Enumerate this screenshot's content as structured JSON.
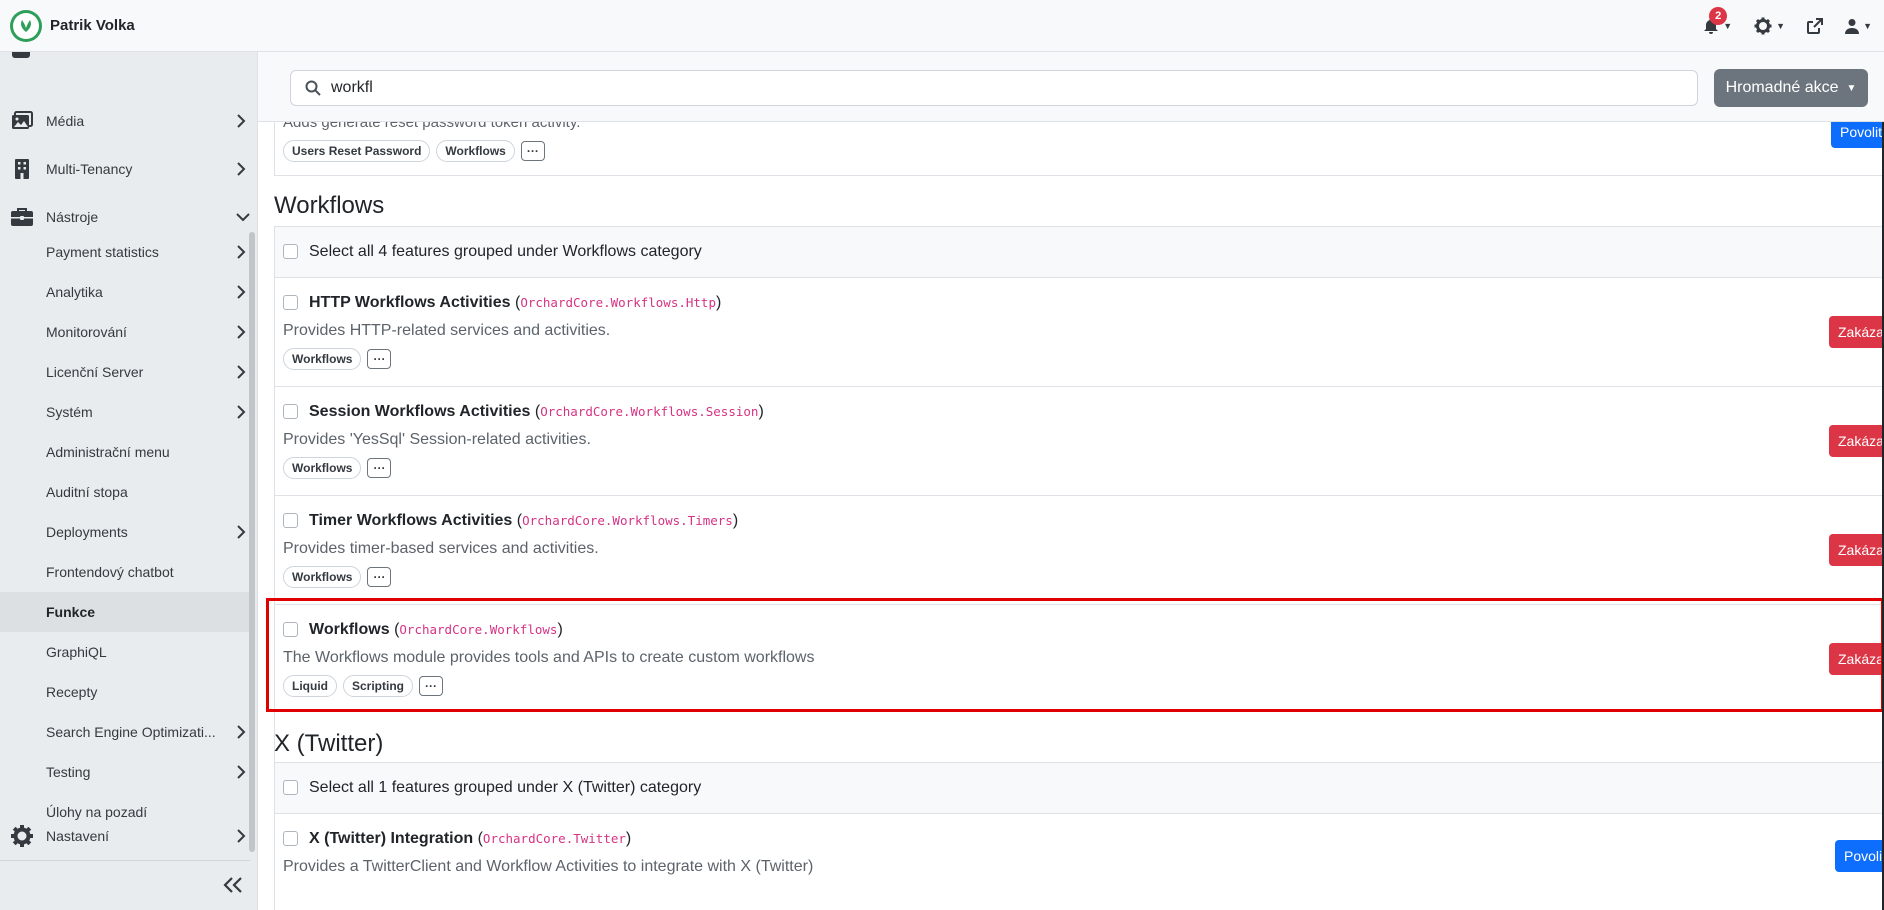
{
  "header": {
    "user_name": "Patrik Volka",
    "notification_count": "2"
  },
  "sidebar": {
    "items": [
      {
        "label": "Média"
      },
      {
        "label": "Multi-Tenancy"
      },
      {
        "label": "Nástroje"
      }
    ],
    "sub_items": [
      {
        "label": "Payment statistics"
      },
      {
        "label": "Analytika"
      },
      {
        "label": "Monitorování"
      },
      {
        "label": "Licenční Server"
      },
      {
        "label": "Systém"
      },
      {
        "label": "Administrační menu"
      },
      {
        "label": "Auditní stopa"
      },
      {
        "label": "Deployments"
      },
      {
        "label": "Frontendový chatbot"
      },
      {
        "label": "Funkce"
      },
      {
        "label": "GraphiQL"
      },
      {
        "label": "Recepty"
      },
      {
        "label": "Search Engine Optimizati..."
      },
      {
        "label": "Testing"
      },
      {
        "label": "Úlohy na pozadí"
      }
    ],
    "settings_label": "Nastavení"
  },
  "search": {
    "value": "workfl",
    "bulk_label": "Hromadné akce"
  },
  "top_partial": {
    "desc": "Adds generate reset password token activity.",
    "tags": [
      "Users Reset Password",
      "Workflows"
    ],
    "button": "Povolit"
  },
  "sections": [
    {
      "heading": "Workflows",
      "select_all": "Select all 4 features grouped under Workflows category",
      "features": [
        {
          "name": "HTTP Workflows Activities",
          "id": "OrchardCore.Workflows.Http",
          "desc": "Provides HTTP-related services and activities.",
          "tags": [
            "Workflows"
          ],
          "button": "Zakázat"
        },
        {
          "name": "Session Workflows Activities",
          "id": "OrchardCore.Workflows.Session",
          "desc": "Provides 'YesSql' Session-related activities.",
          "tags": [
            "Workflows"
          ],
          "button": "Zakázat"
        },
        {
          "name": "Timer Workflows Activities",
          "id": "OrchardCore.Workflows.Timers",
          "desc": "Provides timer-based services and activities.",
          "tags": [
            "Workflows"
          ],
          "button": "Zakázat"
        },
        {
          "name": "Workflows",
          "id": "OrchardCore.Workflows",
          "desc": "The Workflows module provides tools and APIs to create custom workflows",
          "tags": [
            "Liquid",
            "Scripting"
          ],
          "button": "Zakázat"
        }
      ]
    },
    {
      "heading": "X (Twitter)",
      "select_all": "Select all 1 features grouped under X (Twitter) category",
      "features": [
        {
          "name": "X (Twitter) Integration",
          "id": "OrchardCore.Twitter",
          "desc": "Provides a TwitterClient and Workflow Activities to integrate with X (Twitter)",
          "button": "Povolit"
        }
      ]
    }
  ],
  "more_glyph": "···",
  "icons": [
    "logo-icon",
    "bell-icon",
    "gear-icon",
    "external-link-icon",
    "user-icon",
    "search-icon",
    "images-icon",
    "building-icon",
    "toolbox-icon",
    "cog-icon",
    "chevron-right-icon",
    "chevron-down-icon",
    "double-chevron-left-icon"
  ],
  "colors": {
    "danger": "#dc3545",
    "primary": "#0d6efd",
    "code": "#d63384",
    "highlight": "#e00000",
    "brand": "#2e9e5b"
  }
}
